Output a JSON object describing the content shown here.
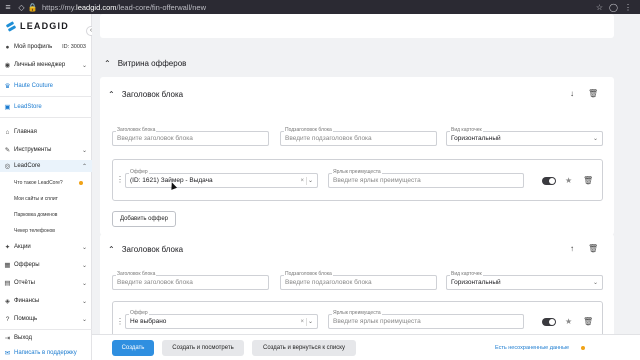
{
  "browser": {
    "url_prefix": "https://my.",
    "url_domain": "leadgid.com",
    "url_path": "/lead-core/fin-offerwall/new"
  },
  "sidebar": {
    "brand": "LEADGID",
    "profile_label": "Мой профиль",
    "profile_id": "ID: 30003",
    "manager_label": "Личный менеджер",
    "haute_couture": "Haute Couture",
    "leadstore": "LeadStore",
    "items": [
      {
        "label": "Главная",
        "icon": "home-icon"
      },
      {
        "label": "Инструменты",
        "icon": "tools-icon"
      },
      {
        "label": "LeadCore",
        "icon": "leadcore-icon"
      }
    ],
    "leadcore_sub": [
      "Что такое LeadCore?",
      "Мои сайты и сплит",
      "Парковка доменов",
      "Чекер телефонов"
    ],
    "items2": [
      {
        "label": "Акции",
        "icon": "promo-icon"
      },
      {
        "label": "Офферы",
        "icon": "offers-icon"
      },
      {
        "label": "Отчёты",
        "icon": "reports-icon"
      },
      {
        "label": "Финансы",
        "icon": "finance-icon"
      },
      {
        "label": "Помощь",
        "icon": "help-icon"
      }
    ],
    "logout": "Выход",
    "support": "Написать в поддержку"
  },
  "main": {
    "section_title": "Витрина офферов",
    "block_title": "Заголовок блока",
    "labels": {
      "block_title": "Заголовок блока",
      "block_subtitle": "Подзаголовок блока",
      "card_type": "Вид карточек",
      "offer": "Оффер",
      "advantage_tag": "Ярлык преимущеста"
    },
    "placeholders": {
      "block_title": "Введите заголовок блока",
      "block_subtitle": "Введите подзаголовок блока",
      "advantage_tag": "Введите ярлык преимущеста"
    },
    "card_type_value": "Горизонтальный",
    "block1_offer": "(ID: 1621) Займер - Выдача",
    "block2_offer": "Не выбрано",
    "add_offer": "Добавить оффер"
  },
  "footer": {
    "create": "Создать",
    "create_view": "Создать и посмотреть",
    "create_back": "Создать и вернуться к списку",
    "unsaved": "Есть несохраненные данные"
  }
}
